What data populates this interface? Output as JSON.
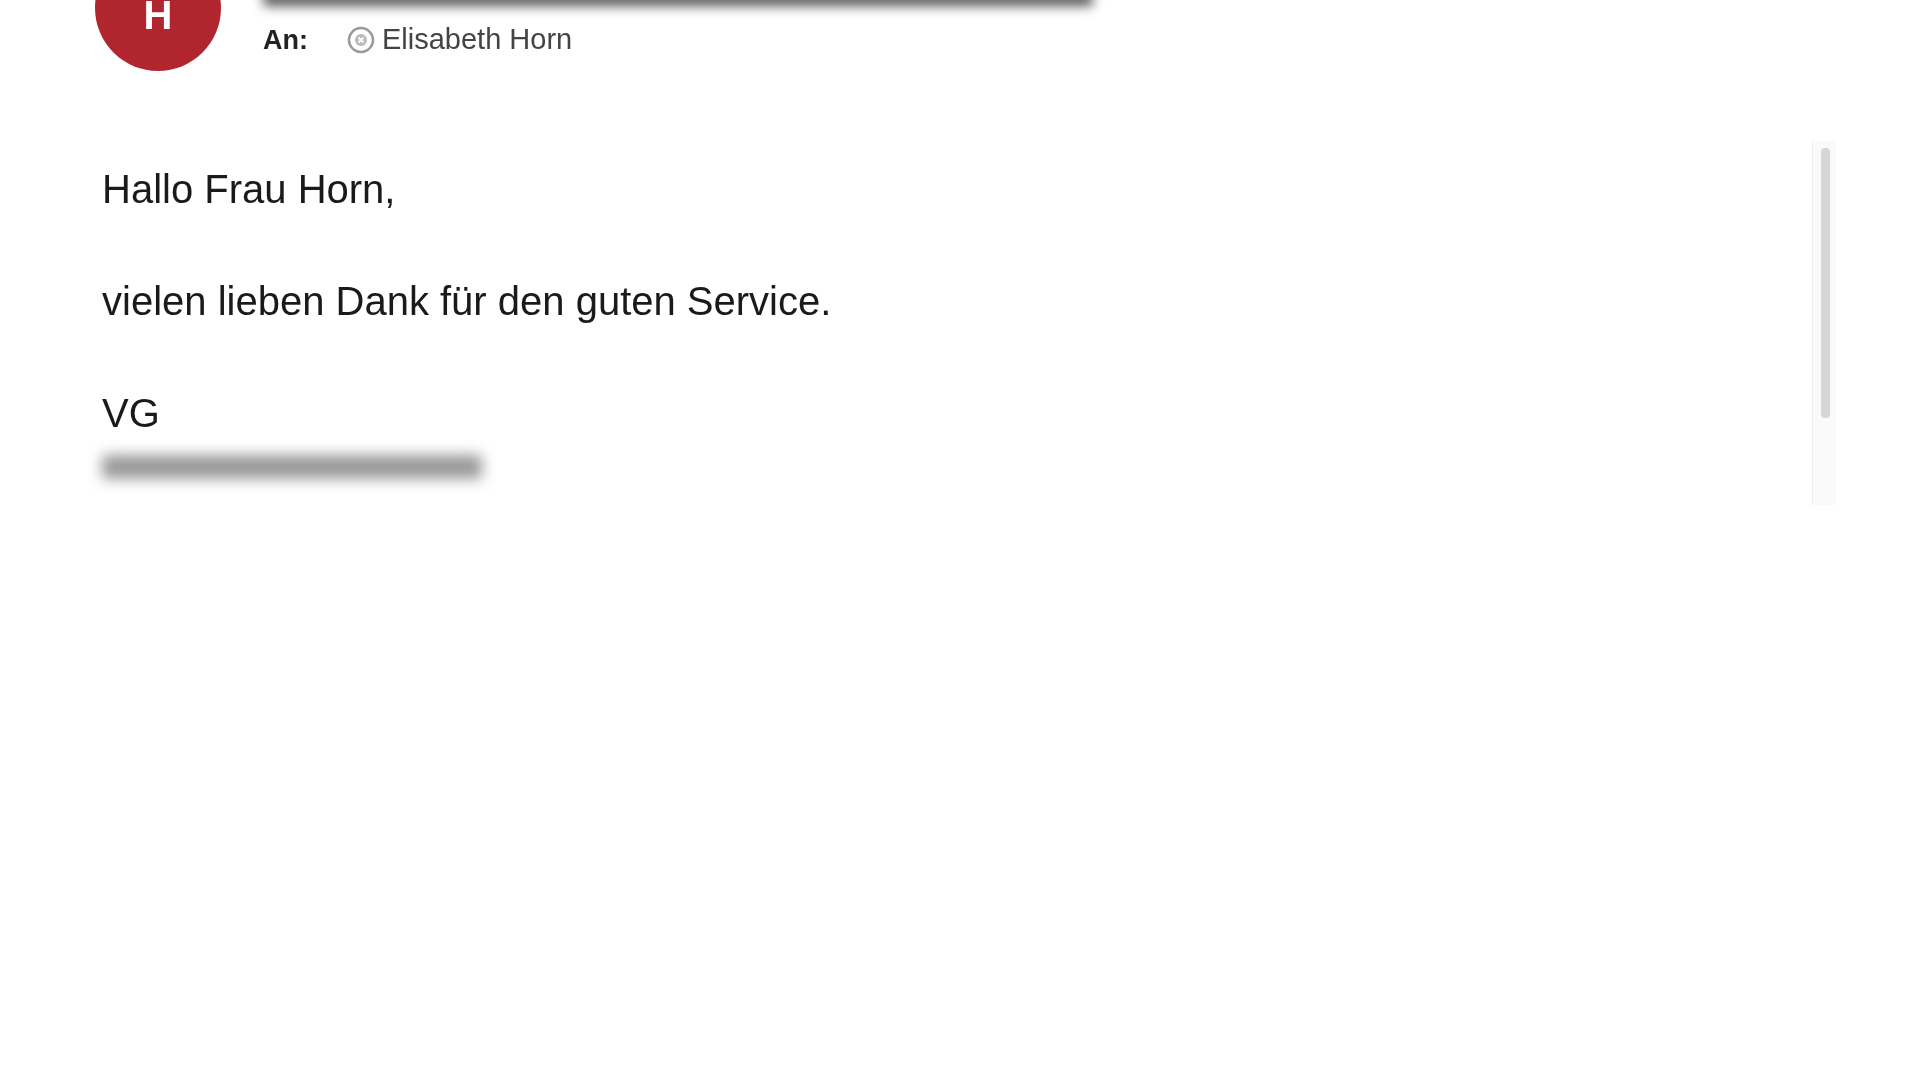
{
  "sender": {
    "avatar_letter": "H",
    "name_redacted": true
  },
  "recipients": {
    "label": "An:",
    "items": [
      {
        "name": "Elisabeth Horn"
      }
    ]
  },
  "body": {
    "paragraphs": [
      [
        "Hallo Frau Horn,"
      ],
      [
        "vielen lieben Dank für den guten Service."
      ],
      [
        "VG"
      ]
    ],
    "signature_redacted": true
  }
}
